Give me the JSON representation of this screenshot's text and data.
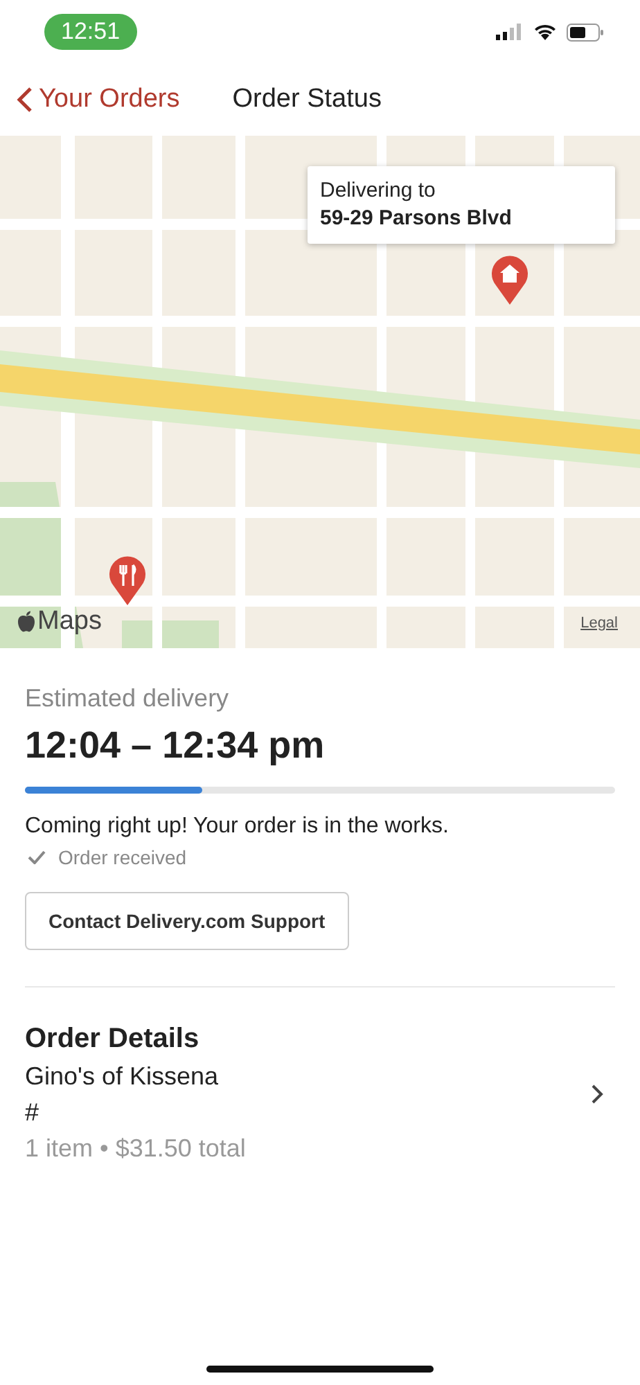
{
  "status_bar": {
    "time": "12:51"
  },
  "nav": {
    "back_label": "Your Orders",
    "title": "Order Status"
  },
  "map": {
    "callout": {
      "label": "Delivering to",
      "address": "59-29 Parsons Blvd"
    },
    "logo": "Maps",
    "legal": "Legal"
  },
  "delivery": {
    "label": "Estimated delivery",
    "window": "12:04 – 12:34 pm",
    "progress": {
      "level": 0.3
    },
    "message": "Coming right up! Your order is in the works.",
    "steps": [
      {
        "label": "Order received",
        "done": true
      }
    ],
    "support_button": "Contact Delivery.com Support"
  },
  "order_details": {
    "heading": "Order Details",
    "restaurant": "Gino's of Kissena",
    "number": "#",
    "summary": "1 item • $31.50 total"
  }
}
